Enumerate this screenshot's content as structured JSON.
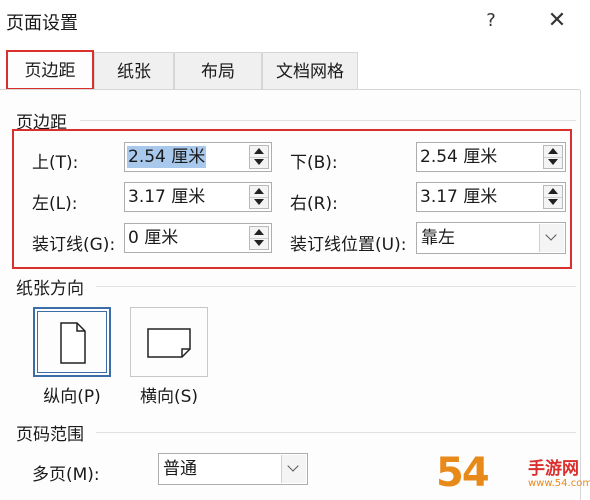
{
  "window": {
    "title": "页面设置",
    "help_label": "?",
    "close_label": "✕"
  },
  "tabs": [
    {
      "label": "页边距",
      "active": true
    },
    {
      "label": "纸张",
      "active": false
    },
    {
      "label": "布局",
      "active": false
    },
    {
      "label": "文档网格",
      "active": false
    }
  ],
  "margins": {
    "section_label": "页边距",
    "top": {
      "label": "上(T):",
      "value": "2.54 厘米"
    },
    "bottom": {
      "label": "下(B):",
      "value": "2.54 厘米"
    },
    "left": {
      "label": "左(L):",
      "value": "3.17 厘米"
    },
    "right": {
      "label": "右(R):",
      "value": "3.17 厘米"
    },
    "gutter": {
      "label": "装订线(G):",
      "value": "0 厘米"
    },
    "gutter_position": {
      "label": "装订线位置(U):",
      "value": "靠左"
    }
  },
  "orientation": {
    "section_label": "纸张方向",
    "portrait_label": "纵向(P)",
    "landscape_label": "横向(S)",
    "selected": "portrait"
  },
  "pages": {
    "section_label": "页码范围",
    "multiple_label": "多页(M):",
    "multiple_value": "普通"
  },
  "watermark": {
    "number": "54",
    "text": "手游网",
    "sub": "www.54.com"
  },
  "colors": {
    "highlight_red": "#d9302e",
    "selection_blue": "#a8c8ec",
    "selected_border": "#3b6ea8"
  }
}
